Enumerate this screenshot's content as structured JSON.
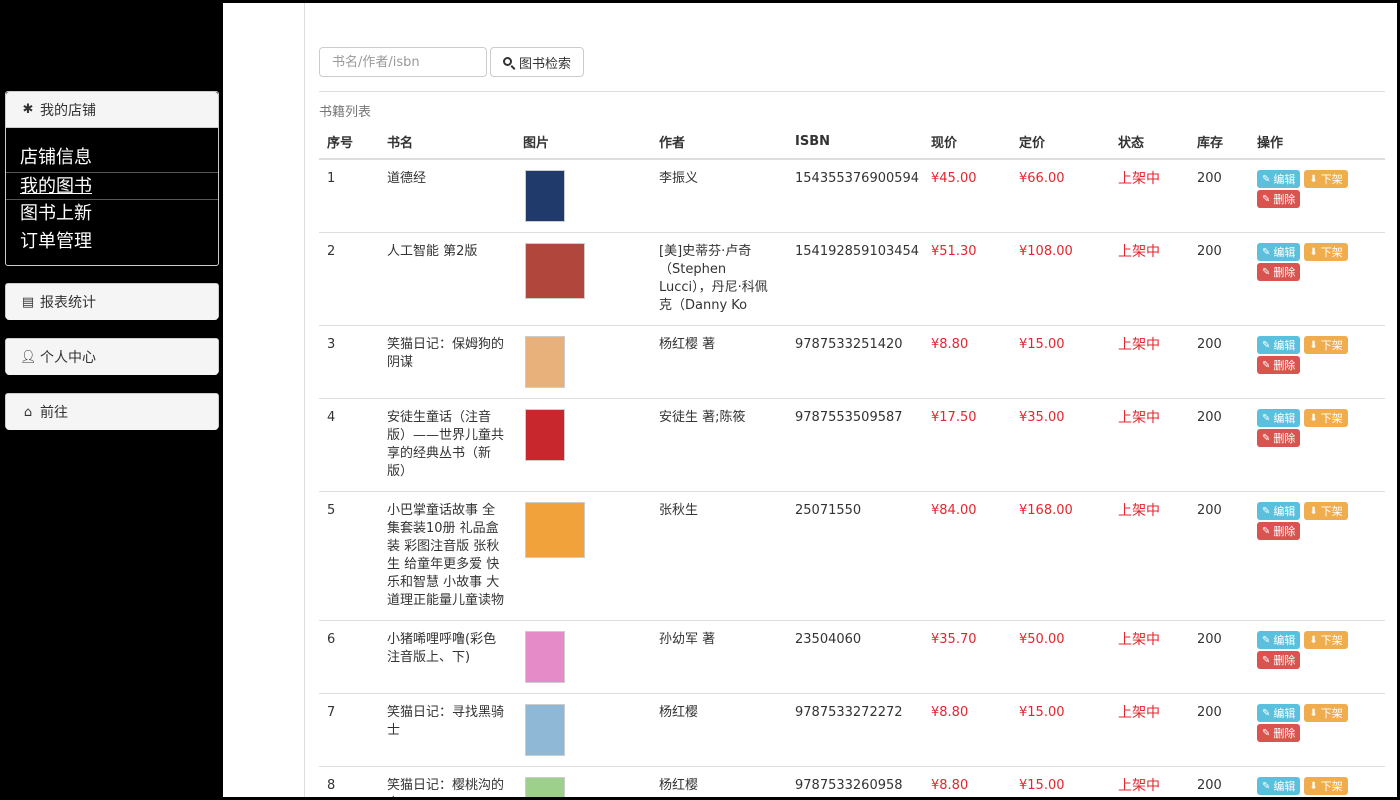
{
  "sidebar": {
    "shop": {
      "title": "我的店铺",
      "items": [
        {
          "label": "店铺信息"
        },
        {
          "label": "我的图书"
        },
        {
          "label": "图书上新"
        },
        {
          "label": "订单管理"
        }
      ]
    },
    "report": {
      "title": "报表统计"
    },
    "personal": {
      "title": "个人中心"
    },
    "goto": {
      "title": "前往"
    }
  },
  "search": {
    "placeholder": "书名/作者/isbn",
    "button_label": "图书检索"
  },
  "list_title": "书籍列表",
  "table": {
    "headers": {
      "index": "序号",
      "name": "书名",
      "image": "图片",
      "author": "作者",
      "isbn": "ISBN",
      "price": "现价",
      "list_price": "定价",
      "status": "状态",
      "stock": "库存",
      "ops": "操作"
    },
    "ops_labels": {
      "edit": "编辑",
      "off": "下架",
      "delete": "删除"
    },
    "rows": [
      {
        "index": "1",
        "name": "道德经",
        "author": "李振义",
        "isbn": "154355376900594",
        "price": "¥45.00",
        "list_price": "¥66.00",
        "status": "上架中",
        "stock": "200",
        "cover_color": "#1f3a6b"
      },
      {
        "index": "2",
        "name": "人工智能 第2版",
        "author": "[美]史蒂芬·卢奇（Stephen Lucci），丹尼·科佩克（Danny Ko",
        "isbn": "154192859103454",
        "price": "¥51.30",
        "list_price": "¥108.00",
        "status": "上架中",
        "stock": "200",
        "cover_color": "#b0463c"
      },
      {
        "index": "3",
        "name": "笑猫日记：保姆狗的阴谋",
        "author": "杨红樱 著",
        "isbn": "9787533251420",
        "price": "¥8.80",
        "list_price": "¥15.00",
        "status": "上架中",
        "stock": "200",
        "cover_color": "#e8b07a"
      },
      {
        "index": "4",
        "name": "安徒生童话（注音版）——世界儿童共享的经典丛书（新版）",
        "author": "安徒生 著;陈筱",
        "isbn": "9787553509587",
        "price": "¥17.50",
        "list_price": "¥35.00",
        "status": "上架中",
        "stock": "200",
        "cover_color": "#c8282d"
      },
      {
        "index": "5",
        "name": "小巴掌童话故事 全集套装10册 礼品盒装 彩图注音版 张秋生 给童年更多爱 快乐和智慧 小故事 大道理正能量儿童读物",
        "author": "张秋生",
        "isbn": "25071550",
        "price": "¥84.00",
        "list_price": "¥168.00",
        "status": "上架中",
        "stock": "200",
        "cover_color": "#f2a23a"
      },
      {
        "index": "6",
        "name": "小猪唏哩呼噜(彩色注音版上、下)",
        "author": "孙幼军 著",
        "isbn": "23504060",
        "price": "¥35.70",
        "list_price": "¥50.00",
        "status": "上架中",
        "stock": "200",
        "cover_color": "#e58bc8"
      },
      {
        "index": "7",
        "name": "笑猫日记：寻找黑骑士",
        "author": "杨红樱",
        "isbn": "9787533272272",
        "price": "¥8.80",
        "list_price": "¥15.00",
        "status": "上架中",
        "stock": "200",
        "cover_color": "#8fb7d6"
      },
      {
        "index": "8",
        "name": "笑猫日记：樱桃沟的春天",
        "author": "杨红樱",
        "isbn": "9787533260958",
        "price": "¥8.80",
        "list_price": "¥15.00",
        "status": "上架中",
        "stock": "200",
        "cover_color": "#9dd08a"
      }
    ]
  }
}
